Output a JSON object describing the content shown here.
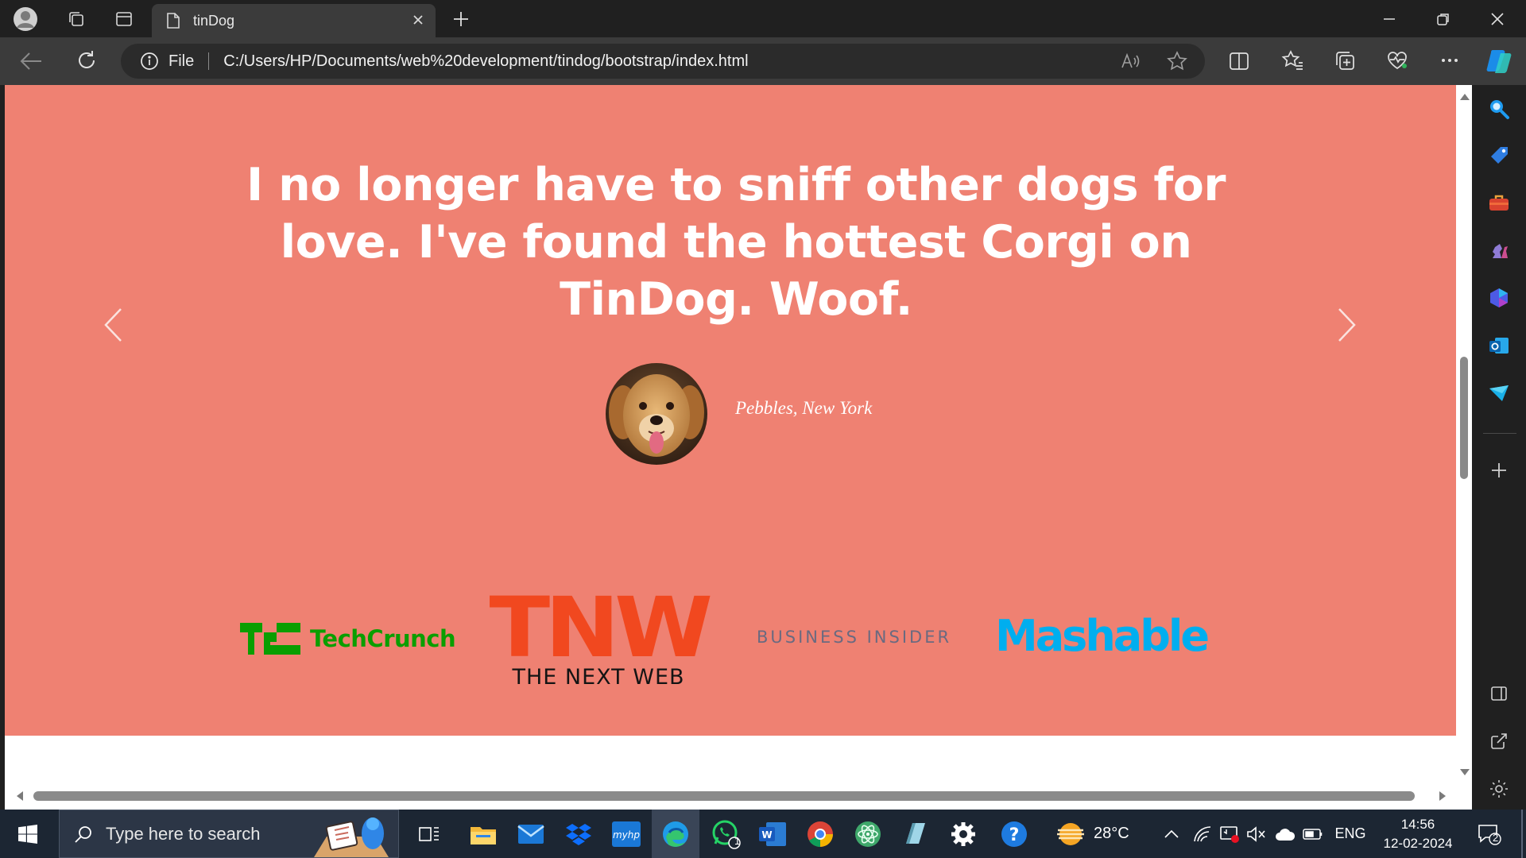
{
  "browser": {
    "tab_title": "tinDog",
    "address_scheme_label": "File",
    "url": "C:/Users/HP/Documents/web%20development/tindog/bootstrap/index.html"
  },
  "testimonial": {
    "quote": "I no longer have to sniff other dogs for love. I've found the hottest Corgi on TinDog. Woof.",
    "author": "Pebbles, New York"
  },
  "press_logos": {
    "techcrunch": "TechCrunch",
    "tnw_mark": "TNW",
    "tnw_name": "THE NEXT WEB",
    "business_insider": "BUSINESS INSIDER",
    "mashable": "Mashable"
  },
  "taskbar": {
    "search_placeholder": "Type here to search",
    "weather": "28°C",
    "language": "ENG",
    "time": "14:56",
    "date": "12-02-2024",
    "whatsapp_badge": "1",
    "notification_badge": "2"
  },
  "colors": {
    "hero_bg": "#ef8172",
    "techcrunch_green": "#0a9e01",
    "tnw_orange": "#f1481f",
    "mashable_blue": "#00aeef"
  }
}
